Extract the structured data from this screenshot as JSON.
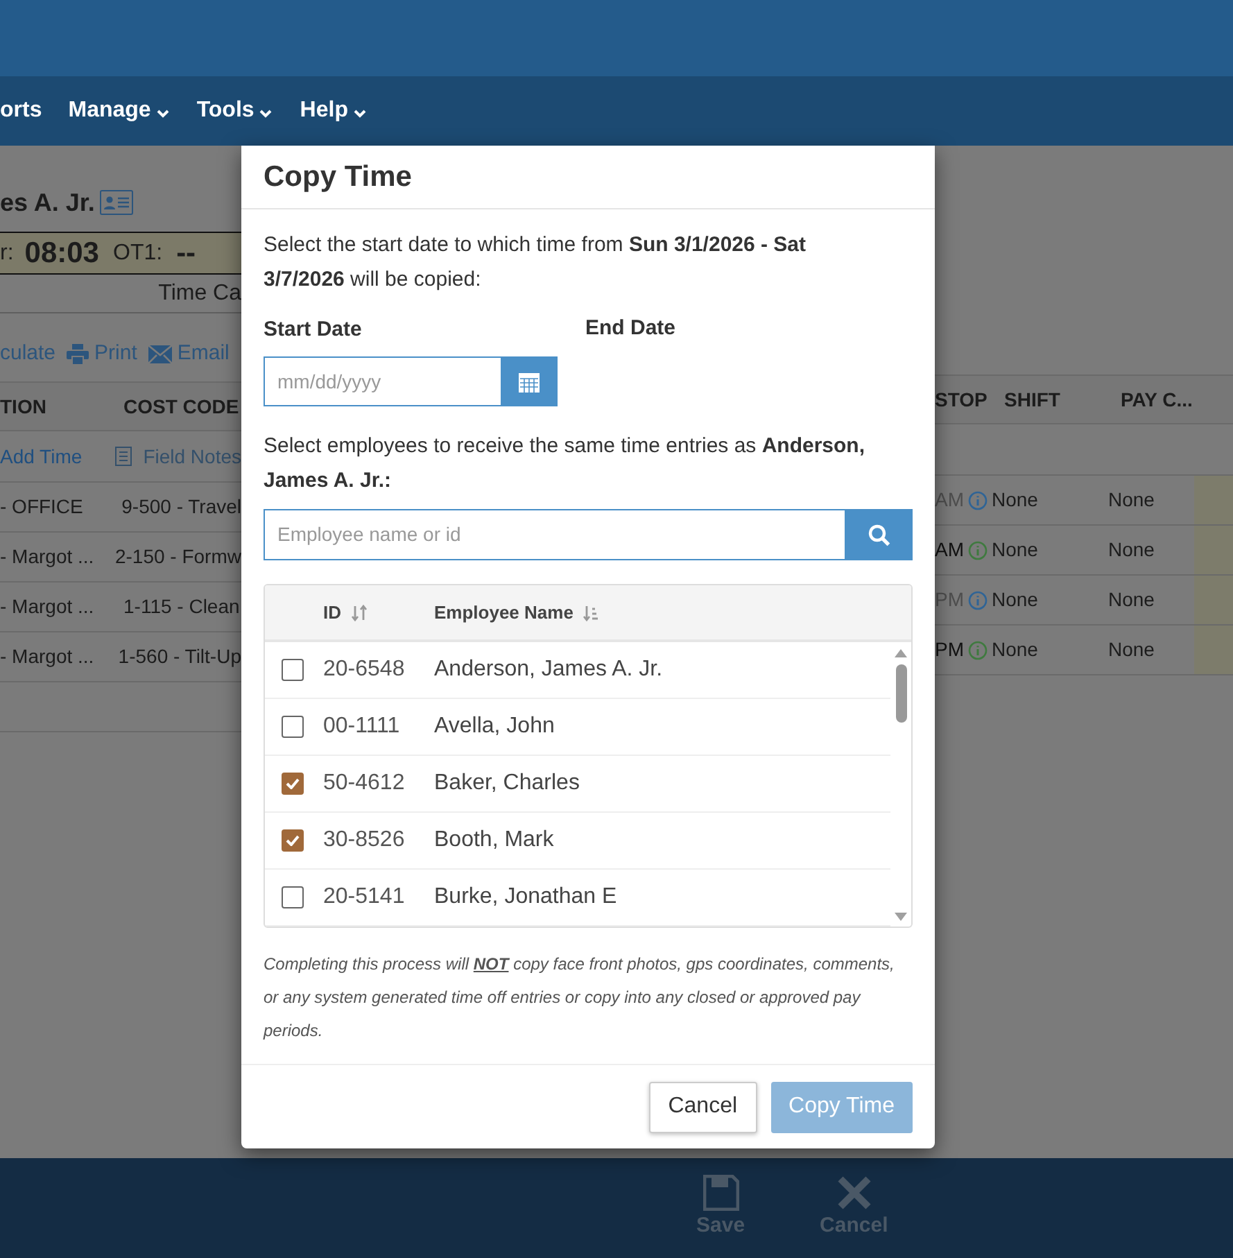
{
  "nav": {
    "items": [
      {
        "label": "orts",
        "dropdown": false
      },
      {
        "label": "Manage",
        "dropdown": true
      },
      {
        "label": "Tools",
        "dropdown": true
      },
      {
        "label": "Help",
        "dropdown": true
      }
    ]
  },
  "employee": {
    "name": "es A. Jr."
  },
  "summary": {
    "reg_label": "r:",
    "reg_value": "08:03",
    "ot1_label": "OT1:",
    "ot1_value": "--",
    "caption": "Time Ca"
  },
  "actions": [
    {
      "label": "culate",
      "kind": "text"
    },
    {
      "label": "Print",
      "kind": "print"
    },
    {
      "label": "Email",
      "kind": "email"
    }
  ],
  "table": {
    "columns_left": [
      "TION",
      "COST CODE"
    ],
    "columns_right": [
      "STOP",
      "SHIFT",
      "PAY C..."
    ],
    "toolbar": [
      {
        "label": "Add Time",
        "disabled": false
      },
      {
        "label": "Field Notes",
        "disabled": true
      }
    ],
    "rows": [
      {
        "location": "- OFFICE",
        "cost_code": "9-500 - Travel",
        "stop": "AM",
        "stop_faded": true,
        "color": "#2f6496",
        "shift": "None",
        "pay_code": "None"
      },
      {
        "location": "- Margot ...",
        "cost_code": "2-150 - Formw",
        "stop": "AM",
        "stop_faded": false,
        "color": "#3f7a3f",
        "shift": "None",
        "pay_code": "None"
      },
      {
        "location": "- Margot ...",
        "cost_code": "1-115 - Clean",
        "stop": "PM",
        "stop_faded": true,
        "color": "#2f6496",
        "shift": "None",
        "pay_code": "None"
      },
      {
        "location": "- Margot ...",
        "cost_code": "1-560 - Tilt-Up",
        "stop": "PM",
        "stop_faded": false,
        "color": "#3f7a3f",
        "shift": "None",
        "pay_code": "None"
      }
    ]
  },
  "bottom_bar": {
    "buttons": [
      {
        "label": "Save",
        "kind": "save",
        "disabled": true
      },
      {
        "label": "Cancel",
        "kind": "cancel",
        "disabled": true
      }
    ]
  },
  "dialog": {
    "title": "Copy Time",
    "intro": "Select the start date to which time from **Sun 3/1/2026 - Sat 3/7/2026** will be copied:",
    "start_date": {
      "label": "Start Date",
      "placeholder": "mm/dd/yyyy"
    },
    "end_date": {
      "label": "End Date"
    },
    "employee_prompt": "Select employees to receive the same time entries as **Anderson, James A. Jr.:**",
    "search": {
      "placeholder": "Employee name or id"
    },
    "columns": [
      {
        "label": "ID",
        "kind": "unsorted"
      },
      {
        "label": "Employee Name",
        "kind": "ascending"
      }
    ],
    "employees": [
      {
        "id": "20-6548",
        "name": "Anderson, James A. Jr.",
        "checked": false
      },
      {
        "id": "00-1111",
        "name": "Avella, John",
        "checked": false
      },
      {
        "id": "50-4612",
        "name": "Baker, Charles",
        "checked": true
      },
      {
        "id": "30-8526",
        "name": "Booth, Mark",
        "checked": true
      },
      {
        "id": "20-5141",
        "name": "Burke, Jonathan E",
        "checked": false
      }
    ],
    "note": "Completing this process will **NOT** copy face front photos, gps coordinates, comments, or any system generated time off entries or copy into any closed or approved pay periods.",
    "buttons": [
      {
        "label": "Cancel",
        "kind": "secondary",
        "disabled": false
      },
      {
        "label": "Copy Time",
        "kind": "primary",
        "disabled": true
      }
    ]
  }
}
